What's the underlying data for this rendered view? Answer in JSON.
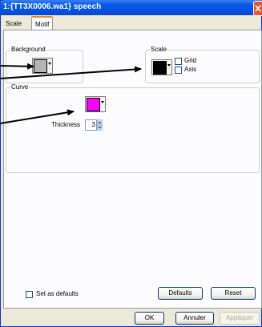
{
  "window": {
    "title": "1:{TT3X0006.wa1} speech"
  },
  "tabs": [
    {
      "label": "Scale"
    },
    {
      "label": "Motif"
    }
  ],
  "background_group": {
    "legend": "Background",
    "color": "#b4b4b4"
  },
  "scale_group": {
    "legend": "Scale",
    "color": "#000000",
    "grid_label": "Grid",
    "axis_label": "Axis"
  },
  "curve_group": {
    "legend": "Curve",
    "color": "#ff00ff",
    "thickness_label": "Thickness",
    "thickness_value": "3"
  },
  "footer": {
    "set_defaults_label": "Set as defaults",
    "defaults_button": "Defaults",
    "reset_button": "Reset"
  },
  "dialog_buttons": {
    "ok": "OK",
    "cancel": "Annuler",
    "apply": "Appliquer"
  },
  "colors": {
    "title_bar": "#0055e5",
    "active_tab_accent": "#e68b2c",
    "annotation_arrows": "#000000"
  }
}
